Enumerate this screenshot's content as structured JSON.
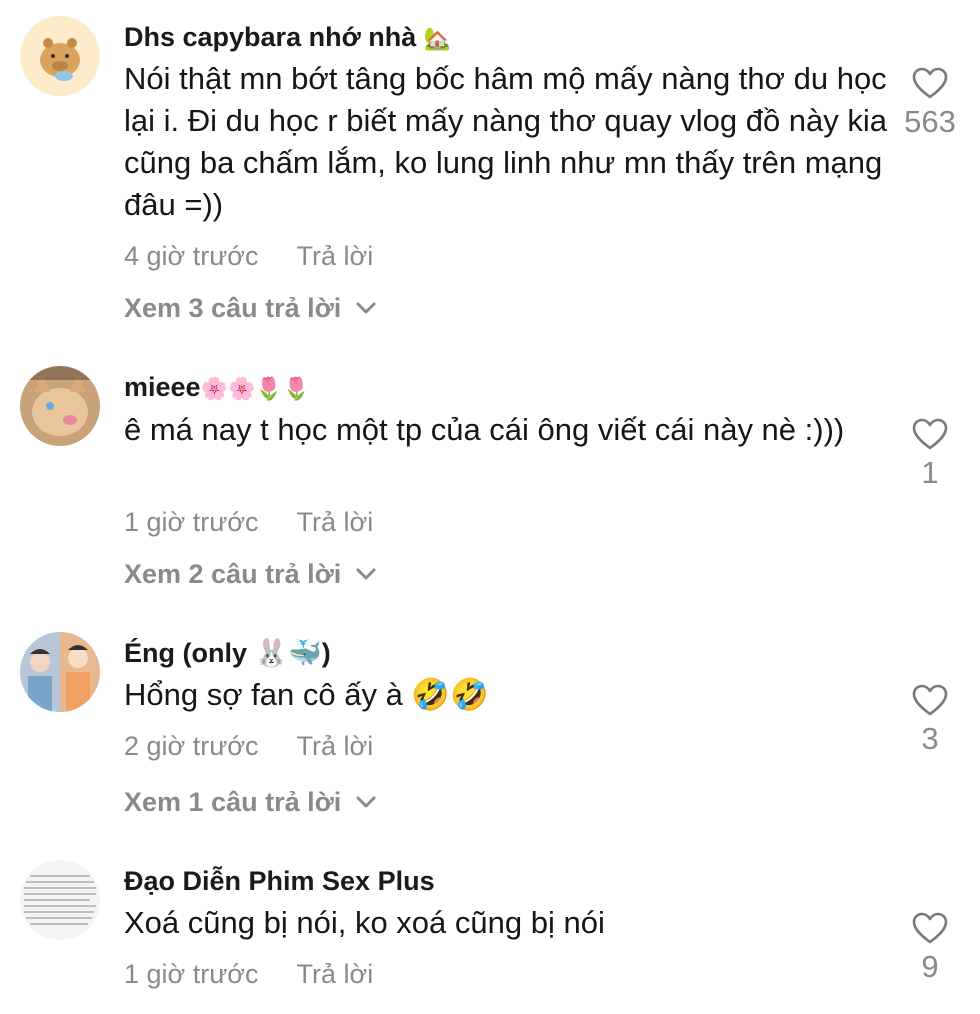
{
  "comments": [
    {
      "name": "Dhs capybara nhớ nhà",
      "name_emoji": "🏡",
      "text": "Nói thật mn bớt tâng bốc hâm mộ mấy nàng thơ du học lại i. Đi du học r biết mấy nàng thơ quay vlog đồ này kia cũng ba chấm lắm, ko lung linh như mn thấy trên mạng đâu =))",
      "time": "4 giờ trước",
      "reply_label": "Trả lời",
      "view_replies": "Xem 3 câu trả lời",
      "likes": "563",
      "avatar_icon": "capybara-avatar-icon"
    },
    {
      "name": "mieee",
      "name_emoji": "🌸🌸🌷🌷",
      "text": "ê má nay t học một tp của cái ông viết cái này nè :)))",
      "time": "1 giờ trước",
      "reply_label": "Trả lời",
      "view_replies": "Xem 2 câu trả lời",
      "likes": "1",
      "avatar_icon": "kitten-avatar-icon"
    },
    {
      "name": "Éng (only 🐰🐳)",
      "name_emoji": "",
      "text": "Hổng sợ fan cô ấy à 🤣🤣",
      "time": "2 giờ trước",
      "reply_label": "Trả lời",
      "view_replies": "Xem 1 câu trả lời",
      "likes": "3",
      "avatar_icon": "photo-collage-avatar-icon"
    },
    {
      "name": "Đạo Diễn Phim Sex Plus",
      "name_emoji": "",
      "text": "Xoá cũng bị nói, ko xoá cũng bị nói",
      "time": "1 giờ trước",
      "reply_label": "Trả lời",
      "view_replies": "",
      "likes": "9",
      "avatar_icon": "document-avatar-icon"
    }
  ],
  "colors": {
    "text": "#161616",
    "muted": "#8a8a8a",
    "background": "#ffffff"
  }
}
